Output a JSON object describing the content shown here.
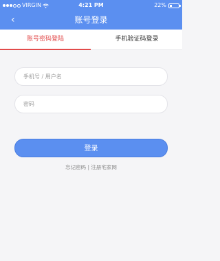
{
  "status_bar": {
    "carrier": "VIRGIN",
    "time": "4:21 PM",
    "battery": "22%",
    "battery_level": 0.22
  },
  "nav": {
    "back_icon": "‹",
    "title": "账号登录"
  },
  "tabs": [
    {
      "label": "账号密码登陆",
      "active": true
    },
    {
      "label": "手机验证码登录",
      "active": false
    }
  ],
  "form": {
    "username_placeholder": "手机号 / 用户名",
    "password_placeholder": "密码",
    "login_label": "登录"
  },
  "links": {
    "forgot": "忘记密码",
    "separator": "|",
    "register": "注册宅家网"
  },
  "colors": {
    "accent": "#5b8ff0",
    "active_tab": "#e24b4b"
  }
}
